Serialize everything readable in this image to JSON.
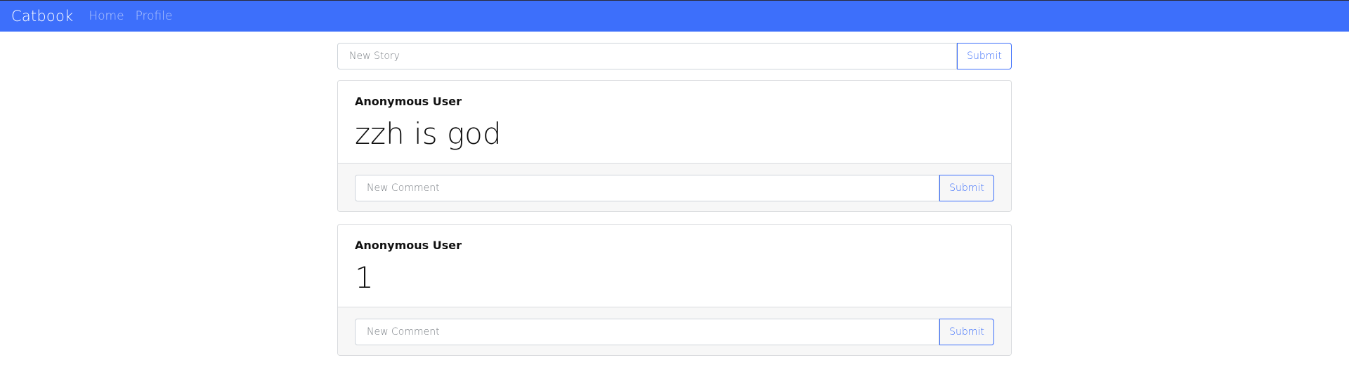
{
  "navbar": {
    "brand": "Catbook",
    "links": [
      "Home",
      "Profile"
    ]
  },
  "new_story": {
    "placeholder": "New Story",
    "submit_label": "Submit"
  },
  "stories": [
    {
      "author": "Anonymous User",
      "content": "zzh is god",
      "comment_placeholder": "New Comment",
      "submit_label": "Submit"
    },
    {
      "author": "Anonymous User",
      "content": "1",
      "comment_placeholder": "New Comment",
      "submit_label": "Submit"
    }
  ],
  "colors": {
    "primary": "#3d6ffb",
    "footer_bg": "#f7f7f7",
    "border": "#d9dbde"
  }
}
